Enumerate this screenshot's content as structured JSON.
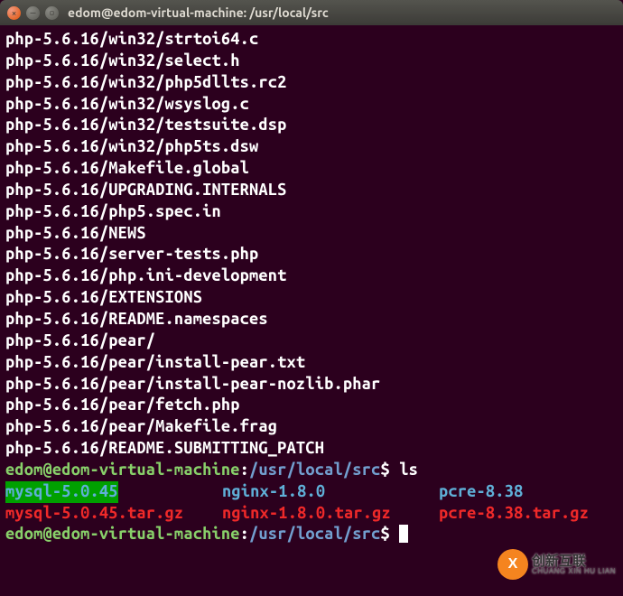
{
  "window": {
    "title": "edom@edom-virtual-machine: /usr/local/src"
  },
  "output_lines": [
    "php-5.6.16/win32/strtoi64.c",
    "php-5.6.16/win32/select.h",
    "php-5.6.16/win32/php5dllts.rc2",
    "php-5.6.16/win32/wsyslog.c",
    "php-5.6.16/win32/testsuite.dsp",
    "php-5.6.16/win32/php5ts.dsw",
    "php-5.6.16/Makefile.global",
    "php-5.6.16/UPGRADING.INTERNALS",
    "php-5.6.16/php5.spec.in",
    "php-5.6.16/NEWS",
    "php-5.6.16/server-tests.php",
    "php-5.6.16/php.ini-development",
    "php-5.6.16/EXTENSIONS",
    "php-5.6.16/README.namespaces",
    "php-5.6.16/pear/",
    "php-5.6.16/pear/install-pear.txt",
    "php-5.6.16/pear/install-pear-nozlib.phar",
    "php-5.6.16/pear/fetch.php",
    "php-5.6.16/pear/Makefile.frag",
    "php-5.6.16/README.SUBMITTING_PATCH"
  ],
  "prompt1": {
    "user_host": "edom@edom-virtual-machine",
    "sep": ":",
    "path": "/usr/local/src",
    "dollar": "$",
    "command": "ls"
  },
  "ls": {
    "row1": {
      "c1": "mysql-5.0.45",
      "c2": "nginx-1.8.0",
      "c3": "pcre-8.38"
    },
    "row2": {
      "c1": "mysql-5.0.45.tar.gz",
      "c2": "nginx-1.8.0.tar.gz",
      "c3": "pcre-8.38.tar.gz"
    }
  },
  "prompt2": {
    "user_host": "edom@edom-virtual-machine",
    "sep": ":",
    "path": "/usr/local/src",
    "dollar": "$"
  },
  "watermark": {
    "logo_letter": "X",
    "cn": "创新互联",
    "en": "CHUANG XIN HU LIAN"
  }
}
